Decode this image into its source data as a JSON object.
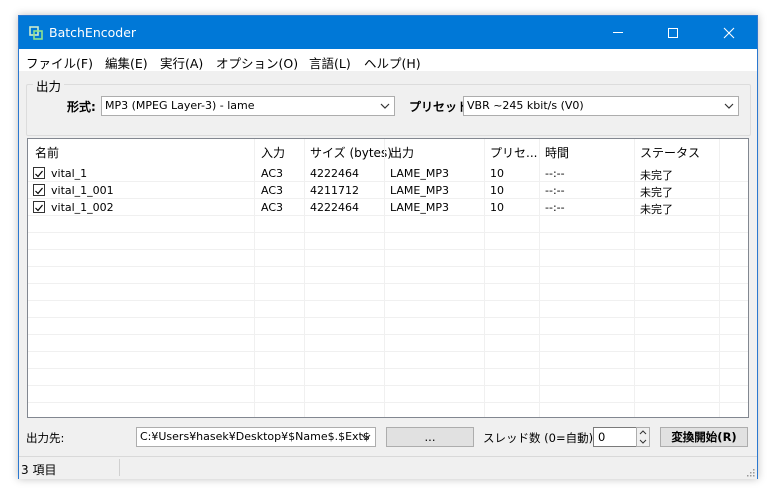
{
  "titlebar": {
    "title": "BatchEncoder"
  },
  "menu": [
    {
      "label": "ファイル(F)"
    },
    {
      "label": "編集(E)"
    },
    {
      "label": "実行(A)"
    },
    {
      "label": "オプション(O)"
    },
    {
      "label": "言語(L)"
    },
    {
      "label": "ヘルプ(H)"
    }
  ],
  "output_group": {
    "title": "出力",
    "format_label": "形式:",
    "format_value": "MP3 (MPEG Layer-3) - lame",
    "preset_label": "プリセット:",
    "preset_value": "VBR ~245 kbit/s (V0)"
  },
  "list": {
    "columns": [
      "名前",
      "入力",
      "サイズ (bytes)",
      "出力",
      "プリセ...",
      "時間",
      "ステータス"
    ],
    "rows": [
      {
        "checked": true,
        "name": "vital_1",
        "input": "AC3",
        "size": "4222464",
        "output": "LAME_MP3",
        "preset": "10",
        "time": "--:--",
        "status": "未完了"
      },
      {
        "checked": true,
        "name": "vital_1_001",
        "input": "AC3",
        "size": "4211712",
        "output": "LAME_MP3",
        "preset": "10",
        "time": "--:--",
        "status": "未完了"
      },
      {
        "checked": true,
        "name": "vital_1_002",
        "input": "AC3",
        "size": "4222464",
        "output": "LAME_MP3",
        "preset": "10",
        "time": "--:--",
        "status": "未完了"
      }
    ]
  },
  "bottom": {
    "output_dest_label": "出力先:",
    "output_path": "C:¥Users¥hasek¥Desktop¥$Name$.$Ext$",
    "browse_label": "...",
    "threads_label": "スレッド数 (0=自動):",
    "threads_value": "0",
    "start_label": "変換開始(R)"
  },
  "status": {
    "items_text": "3 項目"
  }
}
